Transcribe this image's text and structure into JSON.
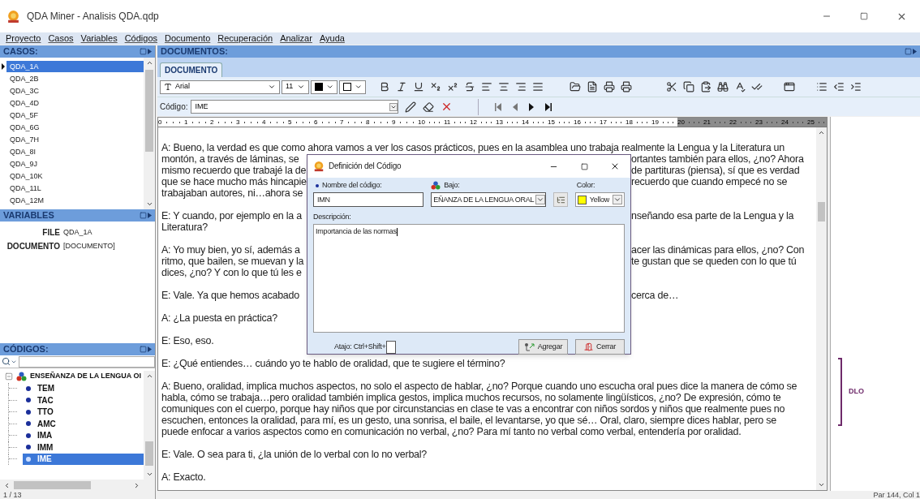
{
  "window": {
    "title": "QDA Miner - Analisis QDA.qdp"
  },
  "menu": [
    "Proyecto",
    "Casos",
    "Variables",
    "Códigos",
    "Documento",
    "Recuperación",
    "Analizar",
    "Ayuda"
  ],
  "cases": {
    "title": "CASOS:",
    "items": [
      {
        "label": "QDA_1A",
        "selected": true
      },
      {
        "label": "QDA_2B",
        "selected": false
      },
      {
        "label": "QDA_3C",
        "selected": false
      },
      {
        "label": "QDA_4D",
        "selected": false
      },
      {
        "label": "QDA_5F",
        "selected": false
      },
      {
        "label": "QDA_6G",
        "selected": false
      },
      {
        "label": "QDA_7H",
        "selected": false
      },
      {
        "label": "QDA_8I",
        "selected": false
      },
      {
        "label": "QDA_9J",
        "selected": false
      },
      {
        "label": "QDA_10K",
        "selected": false
      },
      {
        "label": "QDA_11L",
        "selected": false
      },
      {
        "label": "QDA_12M",
        "selected": false
      }
    ]
  },
  "variables": {
    "title": "VARIABLES",
    "rows": [
      {
        "name": "FILE",
        "value": "QDA_1A"
      },
      {
        "name": "DOCUMENTO",
        "value": "[DOCUMENTO]"
      }
    ]
  },
  "codes": {
    "title": "CÓDIGOS:",
    "tree": [
      {
        "label": "ENSEÑANZA DE LA LENGUA OI",
        "expanded": true,
        "children": [
          {
            "label": "TEM",
            "selected": false
          },
          {
            "label": "TAC",
            "selected": false
          },
          {
            "label": "TTO",
            "selected": false
          },
          {
            "label": "AMC",
            "selected": false
          },
          {
            "label": "IMA",
            "selected": false
          },
          {
            "label": "IMM",
            "selected": false
          },
          {
            "label": "IME",
            "selected": true
          }
        ]
      }
    ]
  },
  "documents": {
    "title": "DOCUMENTOS:",
    "tabs": [
      {
        "label": "DOCUMENTO",
        "selected": true
      }
    ],
    "font": "Arial",
    "size": "11",
    "code_label": "Código:",
    "code_value": "IME",
    "ruler": [
      "0",
      "1",
      "2",
      "3",
      "4",
      "5",
      "6",
      "7",
      "8",
      "9",
      "10",
      "11",
      "12",
      "13",
      "14",
      "15",
      "16",
      "17",
      "18",
      "19",
      "20",
      "21",
      "22",
      "23",
      "24",
      "25"
    ],
    "paragraphs": [
      [
        {
          "left": "A: Bueno, la verdad es que como ahora vamos a ver los casos prácticos, pues en la asamblea uno trabaja realmente la Lengua y la Literatura un"
        },
        {
          "left": "montón, a través de láminas, se",
          "right": "ortantes también para ellos, ¿no? Ahora"
        },
        {
          "left": "mismo recuerdo que trabajé la de",
          "right": "de partituras (piensa), sí que es verdad"
        },
        {
          "left": "que se hace mucho más hincapie",
          "right": "recuerdo que cuando empecé no se"
        },
        {
          "left": "trabajaban autores, ni…ahora se"
        }
      ],
      [
        {
          "left": "E: Y cuando, por ejemplo en la a",
          "right": "nseñando esa parte de la Lengua y la"
        },
        {
          "left": "Literatura?"
        }
      ],
      [
        {
          "left": "A: Yo muy bien, yo sí, además a",
          "right": "acer las dinámicas para ellos, ¿no? Con"
        },
        {
          "left": "ritmo, que bailen, se muevan y la",
          "right": "te gustan que se queden con lo que tú"
        },
        {
          "left": "dices, ¿no? Y con lo que tú les e"
        }
      ],
      [
        {
          "left": "E: Vale. Ya que hemos acabado",
          "right": "cerca de…"
        }
      ],
      [
        {
          "left": "A: ¿La puesta en práctica?"
        }
      ],
      [
        {
          "left": "E: Eso, eso."
        }
      ],
      [
        {
          "left": "E: ¿Qué entiendes… cuándo yo te hablo de oralidad, que te sugiere el término?"
        }
      ],
      [
        {
          "left": "A: Bueno, oralidad, implica muchos aspectos, no solo el aspecto de hablar, ¿no? Porque cuando uno escucha oral pues dice la manera de cómo se"
        },
        {
          "left": "habla, cómo se trabaja…pero oralidad también implica gestos, implica muchos recursos, no solamente lingüísticos, ¿no? De expresión, cómo te"
        },
        {
          "left": "comuniques con el cuerpo, porque hay niños que por circunstancias en clase te vas a encontrar con niños sordos y niños que realmente pues no"
        },
        {
          "left": "escuchen, entonces la oralidad, para mí, es un gesto, una sonrisa, el baile, el levantarse, yo que sé… Oral, claro, siempre dices hablar, pero se"
        },
        {
          "left": "puede enfocar a varios aspectos como en comunicación no verbal, ¿no? Para mí tanto no verbal como verbal, entendería por oralidad."
        }
      ],
      [
        {
          "left": "E: Vale. O sea para ti, ¿la unión de lo verbal con lo no verbal?"
        }
      ],
      [
        {
          "left": "A: Exacto."
        }
      ]
    ],
    "margin_codes": [
      {
        "label": "DLO",
        "color": "#6e2a6a"
      }
    ]
  },
  "dialog": {
    "title": "Definición del Código",
    "name_label": "Nombre del código:",
    "name_value": "IMN",
    "under_label": "Bajo:",
    "under_value": "EÑANZA DE LA LENGUA ORAL",
    "color_label": "Color:",
    "color_value": "Yellow",
    "description_label": "Descripción:",
    "description_value": "Importancia de las normas",
    "shortcut_label": "Atajo: Ctrl+Shift+",
    "buttons": [
      "Agregar",
      "Cerrar"
    ]
  },
  "status_bar": {
    "left": "1 / 13",
    "right": "Par 144, Col 1"
  }
}
